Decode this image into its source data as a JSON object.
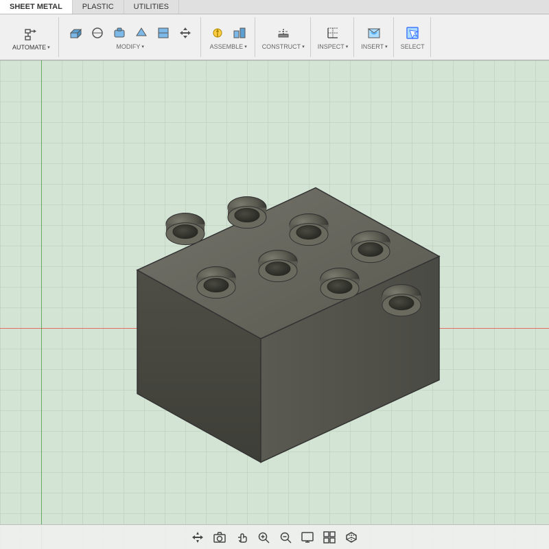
{
  "tabs": [
    {
      "label": "SHEET METAL"
    },
    {
      "label": "PLASTIC"
    },
    {
      "label": "UTILITIES"
    }
  ],
  "ribbon": {
    "groups": [
      {
        "id": "automate",
        "label": "AUTOMATE",
        "has_dropdown": true,
        "icons": [
          "automate-icon"
        ]
      },
      {
        "id": "modify",
        "label": "MODIFY",
        "has_dropdown": true,
        "icons": [
          "extrude-icon",
          "shape1-icon",
          "shape2-icon",
          "shape3-icon",
          "shape4-icon",
          "move-icon"
        ]
      },
      {
        "id": "assemble",
        "label": "ASSEMBLE",
        "has_dropdown": true,
        "icons": [
          "assemble1-icon",
          "assemble2-icon"
        ]
      },
      {
        "id": "construct",
        "label": "CONSTRUCT",
        "has_dropdown": true,
        "icons": [
          "construct1-icon"
        ]
      },
      {
        "id": "inspect",
        "label": "INSPECT",
        "has_dropdown": true,
        "icons": [
          "inspect1-icon"
        ]
      },
      {
        "id": "insert",
        "label": "INSERT",
        "has_dropdown": true,
        "icons": [
          "insert1-icon"
        ]
      },
      {
        "id": "select",
        "label": "SELECT",
        "has_dropdown": false,
        "icons": [
          "select-icon"
        ]
      }
    ]
  },
  "statusbar": {
    "icons": [
      "move-icon",
      "camera-icon",
      "hand-icon",
      "zoom-in-icon",
      "zoom-fit-icon",
      "display-icon",
      "grid-icon",
      "cube-icon"
    ]
  },
  "colors": {
    "brick_body": "#5a5a50",
    "brick_top": "#6b6b60",
    "brick_side": "#4a4a42",
    "brick_stud": "#5a5a50",
    "brick_stud_inner": "#4a4a42",
    "grid_bg": "#d4e4d4",
    "toolbar_bg": "#f0f0f0"
  }
}
